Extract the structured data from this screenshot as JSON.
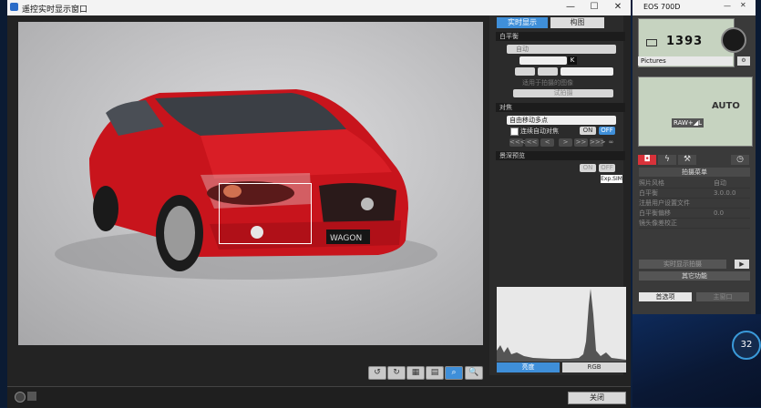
{
  "live_view_window": {
    "title": "遥控实时显示窗口",
    "minimize": "—",
    "maximize": "☐",
    "close": "✕",
    "tabs": [
      "实时显示",
      "构图"
    ],
    "white_balance": {
      "header": "白平衡",
      "mode": "自动",
      "kelvin_unit": "K",
      "apply_checkbox": "适用于拍摄的图像",
      "test_button": "试拍摄"
    },
    "focus": {
      "header": "对焦",
      "af_mode": "自由移动多点",
      "continuous_af": "连续自动对焦",
      "on": "ON",
      "off": "OFF",
      "nav": [
        "<<<",
        "<<",
        "<",
        ">",
        ">>",
        ">>>",
        "∞"
      ]
    },
    "dof_preview": {
      "header": "景深预览",
      "on": "ON",
      "off": "OFF",
      "badge": "Exp.SIM"
    },
    "histogram_tabs": [
      "亮度",
      "RGB"
    ],
    "close_button": "关闭",
    "car_plate": "WAGON"
  },
  "eos_window": {
    "title": "EOS 700D",
    "shots_remaining": "1393",
    "picture_style": "Pictures",
    "raw_label": "RAW+◢L",
    "wb_label": "AUTO",
    "menu_title": "拍摄菜单",
    "menu_items": [
      {
        "label": "照片风格",
        "value": "自动"
      },
      {
        "label": "白平衡",
        "value": "3.0.0.0"
      },
      {
        "label": "注册用户设置文件",
        "value": ""
      },
      {
        "label": "白平衡偏移",
        "value": "0.0"
      },
      {
        "label": "镜头像差校正",
        "value": ""
      }
    ],
    "live_shoot_button": "实时显示拍摄",
    "other_functions": "其它功能",
    "preferences_button": "首选项",
    "main_window_button": "主窗口"
  },
  "desktop": {
    "temperature": "32"
  }
}
